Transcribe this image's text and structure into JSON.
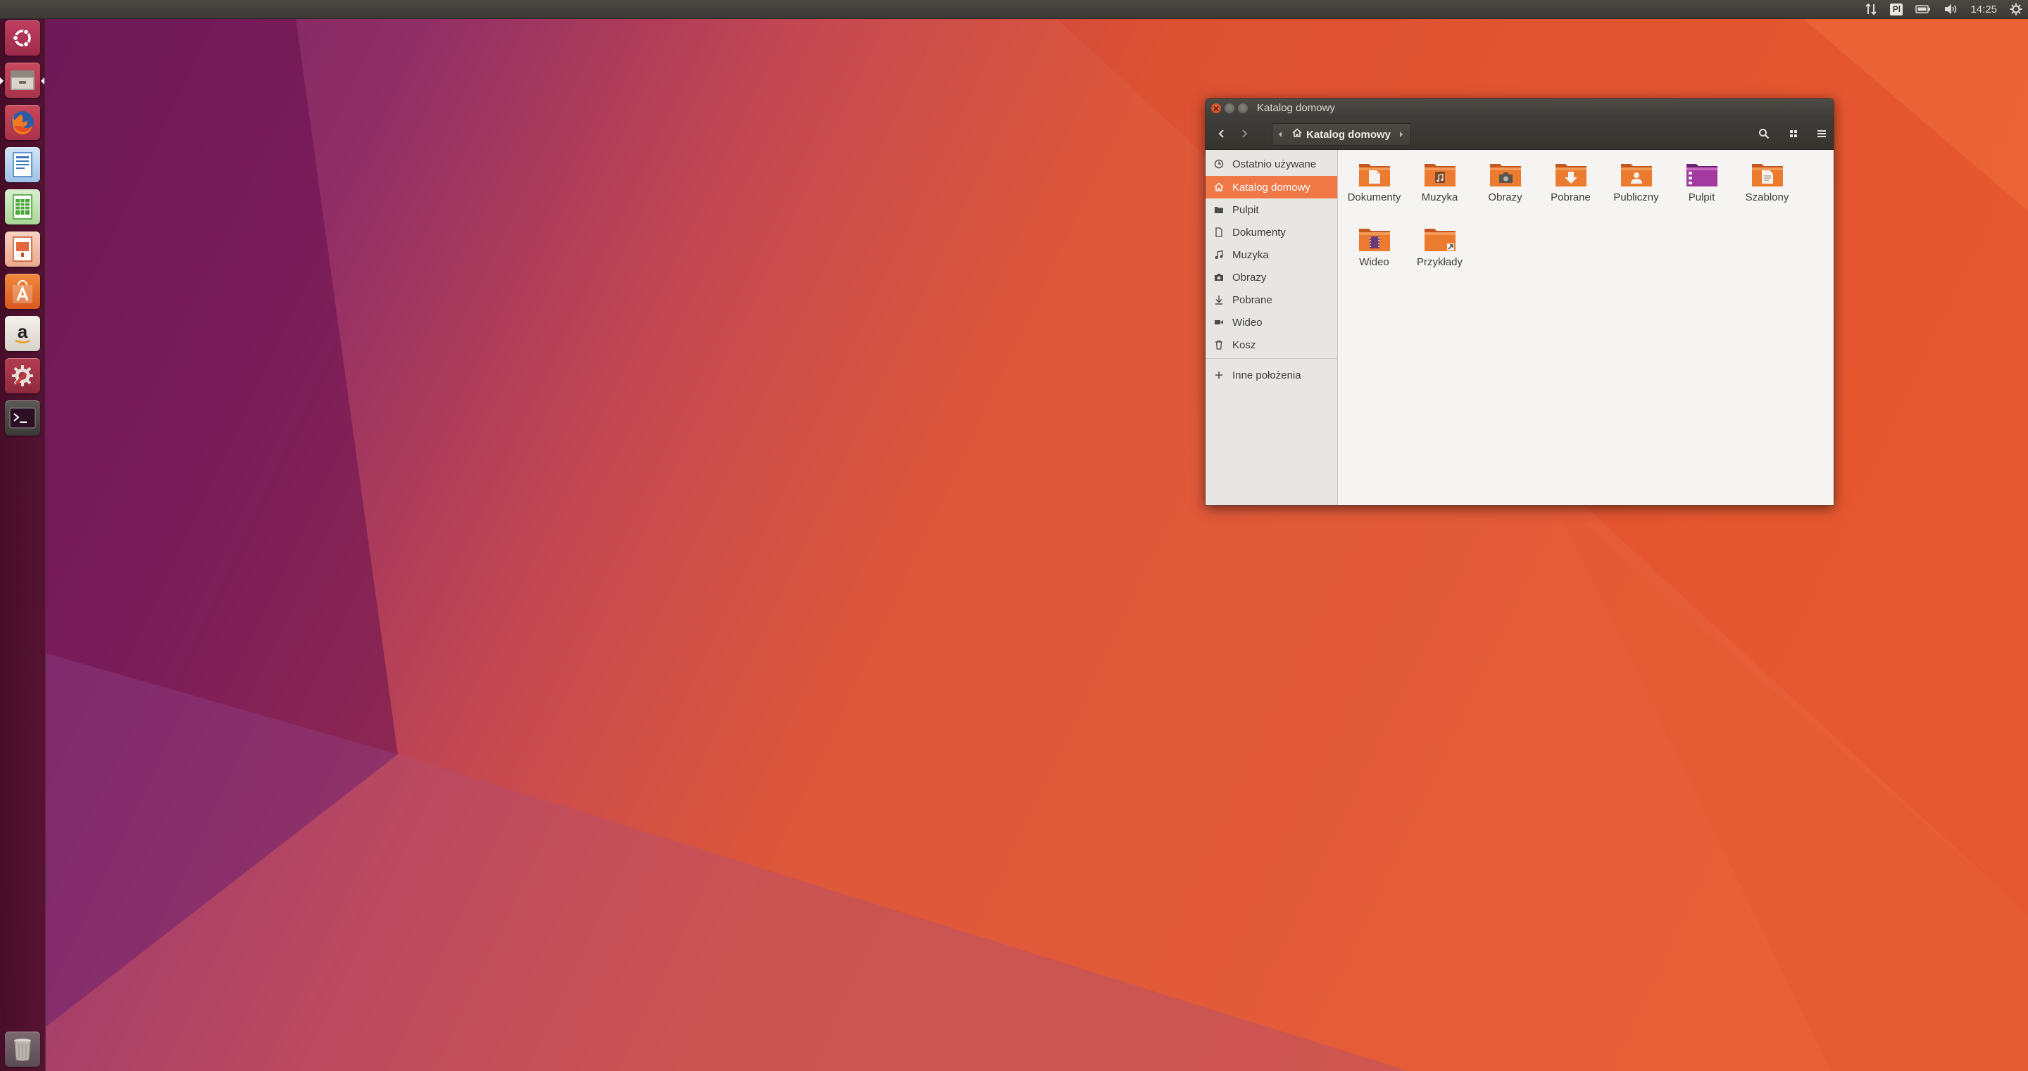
{
  "top_panel": {
    "keyboard_layout": "Pl",
    "clock": "14:25",
    "icons": [
      "network-icon",
      "keyboard-layout-icon",
      "battery-icon",
      "volume-icon",
      "session-gear-icon"
    ]
  },
  "launcher": {
    "items": [
      {
        "name": "ubuntu-dash",
        "icon": "ubuntu-logo-icon"
      },
      {
        "name": "files",
        "icon": "file-cabinet-icon",
        "running": true
      },
      {
        "name": "firefox",
        "icon": "firefox-icon"
      },
      {
        "name": "libreoffice-writer",
        "icon": "writer-icon"
      },
      {
        "name": "libreoffice-calc",
        "icon": "calc-icon"
      },
      {
        "name": "libreoffice-impress",
        "icon": "impress-icon"
      },
      {
        "name": "ubuntu-software",
        "icon": "software-bag-icon"
      },
      {
        "name": "amazon",
        "icon": "amazon-icon"
      },
      {
        "name": "system-settings",
        "icon": "settings-icon"
      },
      {
        "name": "terminal",
        "icon": "terminal-icon"
      },
      {
        "name": "trash",
        "icon": "trash-icon"
      }
    ]
  },
  "window": {
    "title": "Katalog domowy",
    "path_current": "Katalog domowy",
    "sidebar": {
      "items": [
        {
          "label": "Ostatnio używane",
          "icon": "clock-icon"
        },
        {
          "label": "Katalog domowy",
          "icon": "home-icon",
          "active": true
        },
        {
          "label": "Pulpit",
          "icon": "desktop-folder-icon"
        },
        {
          "label": "Dokumenty",
          "icon": "document-icon"
        },
        {
          "label": "Muzyka",
          "icon": "music-note-icon"
        },
        {
          "label": "Obrazy",
          "icon": "camera-icon"
        },
        {
          "label": "Pobrane",
          "icon": "download-arrow-icon"
        },
        {
          "label": "Wideo",
          "icon": "video-camera-icon"
        },
        {
          "label": "Kosz",
          "icon": "trash-icon"
        }
      ],
      "other_locations": {
        "label": "Inne położenia",
        "icon": "plus-icon"
      }
    },
    "folders": [
      {
        "label": "Dokumenty",
        "emblem": "document"
      },
      {
        "label": "Muzyka",
        "emblem": "music"
      },
      {
        "label": "Obrazy",
        "emblem": "camera"
      },
      {
        "label": "Pobrane",
        "emblem": "download"
      },
      {
        "label": "Publiczny",
        "emblem": "person"
      },
      {
        "label": "Pulpit",
        "emblem": "desktop"
      },
      {
        "label": "Szablony",
        "emblem": "template"
      },
      {
        "label": "Wideo",
        "emblem": "film"
      },
      {
        "label": "Przykłady",
        "emblem": "link"
      }
    ],
    "colors": {
      "accent": "#f07746",
      "folder": "#e8702c",
      "desktop_folder": "#a33aa0"
    }
  }
}
